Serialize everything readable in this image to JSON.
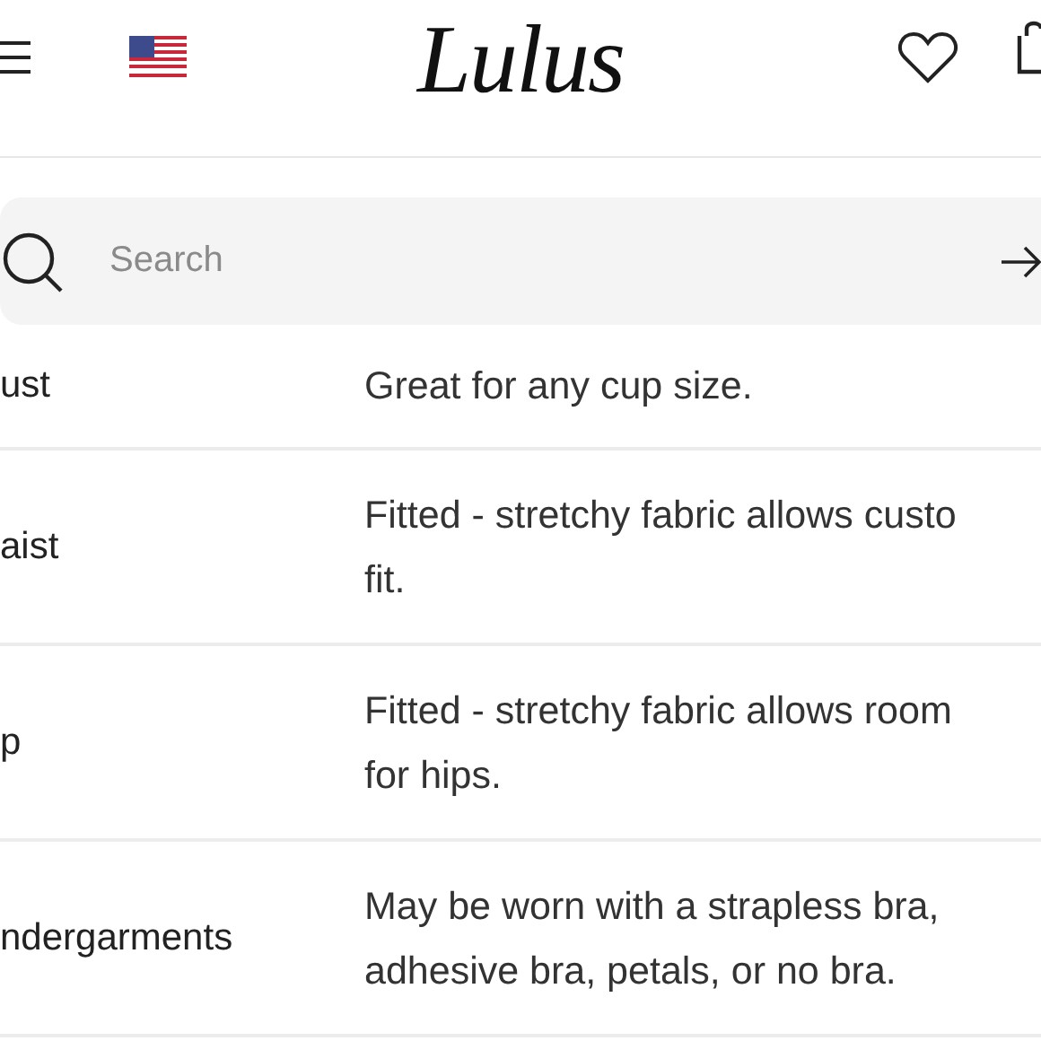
{
  "header": {
    "logo": "Lulus"
  },
  "search": {
    "placeholder": "Search"
  },
  "details": [
    {
      "label": "ust",
      "lines": [
        "Great for any cup size."
      ]
    },
    {
      "label": "aist",
      "lines": [
        "Fitted - stretchy fabric allows custo",
        "fit."
      ]
    },
    {
      "label": "p",
      "lines": [
        "Fitted - stretchy fabric allows room",
        "for hips."
      ]
    },
    {
      "label": "ndergarments",
      "lines": [
        "May be worn with a strapless bra,",
        "adhesive bra, petals, or no bra."
      ]
    }
  ]
}
